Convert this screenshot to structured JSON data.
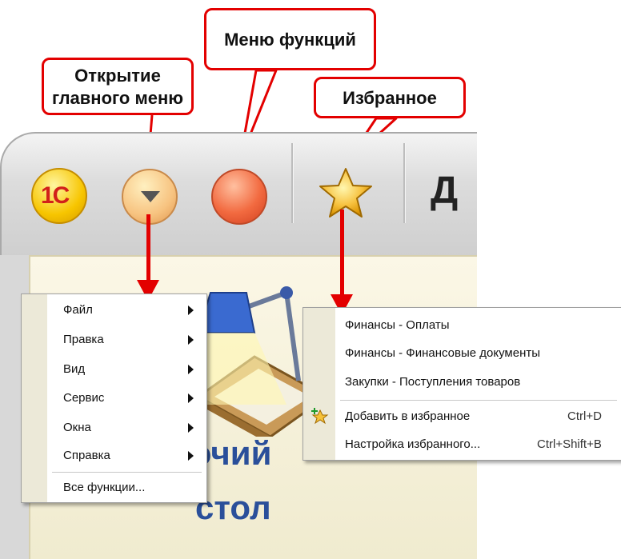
{
  "callouts": {
    "open_main_menu": [
      "Открытие",
      "главного меню"
    ],
    "functions_menu": "Меню функций",
    "favorites": "Избранное"
  },
  "toolbar": {
    "logo_label": "1С",
    "truncated_label": "Д",
    "icons": [
      "1c-logo-icon",
      "main-menu-dropdown-icon",
      "functions-menu-icon",
      "star-icon"
    ]
  },
  "desktop": {
    "title_line1": "Рабочий",
    "title_line2": "стол"
  },
  "main_menu": {
    "items": [
      {
        "label": "Файл",
        "submenu": true
      },
      {
        "label": "Правка",
        "submenu": true
      },
      {
        "label": "Вид",
        "submenu": true
      },
      {
        "label": "Сервис",
        "submenu": true
      },
      {
        "label": "Окна",
        "submenu": true
      },
      {
        "label": "Справка",
        "submenu": true
      }
    ],
    "all_functions": "Все функции..."
  },
  "favorites_menu": {
    "items": [
      "Финансы - Оплаты",
      "Финансы - Финансовые документы",
      "Закупки - Поступления товаров"
    ],
    "add": {
      "label": "Добавить в избранное",
      "shortcut": "Ctrl+D"
    },
    "settings": {
      "label": "Настройка избранного...",
      "shortcut": "Ctrl+Shift+B"
    }
  },
  "colors": {
    "callout_border": "#e30000",
    "arrow": "#e30000",
    "desktop_title": "#2a4f9a",
    "menu_gutter": "#ece9d8"
  }
}
